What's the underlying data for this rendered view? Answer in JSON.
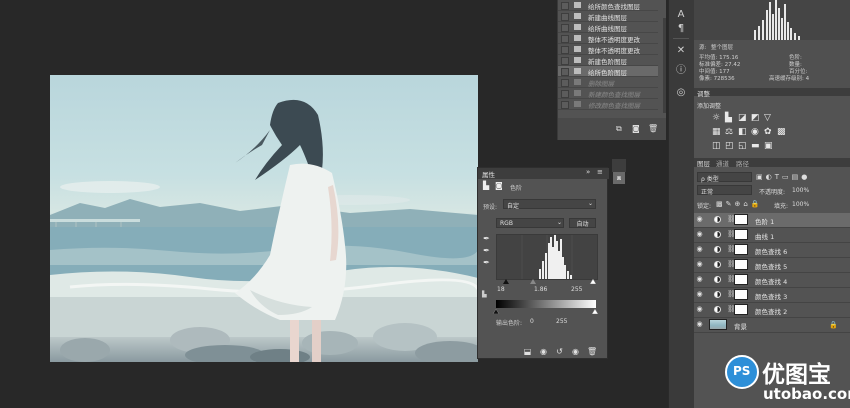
{
  "history": {
    "items": [
      {
        "label": "给所颜色查找图层",
        "state": "normal"
      },
      {
        "label": "新建曲线图层",
        "state": "normal"
      },
      {
        "label": "给所曲线图层",
        "state": "normal"
      },
      {
        "label": "整体不透明度更改",
        "state": "normal"
      },
      {
        "label": "整体不透明度更改",
        "state": "normal"
      },
      {
        "label": "新建色阶图层",
        "state": "normal"
      },
      {
        "label": "给所色阶图层",
        "state": "selected"
      },
      {
        "label": "删除图层",
        "state": "dim"
      },
      {
        "label": "新建颜色查找图层",
        "state": "dim"
      },
      {
        "label": "修改颜色查找图层",
        "state": "dim"
      }
    ]
  },
  "info": {
    "source_label": "源:",
    "source_value": "整个图层",
    "mean": "平均值: 175.16",
    "stddev": "标准偏差: 27.42",
    "median": "中间值: 177",
    "pixels": "像素: 728536",
    "level": "色阶:",
    "count": "数量:",
    "percentile": "百分位:",
    "cache": "高速缓存级别: 4"
  },
  "adjustments": {
    "tab": "调整",
    "title": "添加调整"
  },
  "layers_panel": {
    "tabs": [
      "图层",
      "通道",
      "路径"
    ],
    "kind_filter": "ρ 类型",
    "blend_mode": "正常",
    "opacity_label": "不透明度:",
    "opacity_value": "100%",
    "lock_label": "锁定:",
    "fill_label": "填充:",
    "fill_value": "100%",
    "layers": [
      {
        "name": "色阶 1",
        "selected": true,
        "type": "adjustment"
      },
      {
        "name": "曲线 1",
        "selected": false,
        "type": "adjustment"
      },
      {
        "name": "颜色查找 6",
        "selected": false,
        "type": "adjustment"
      },
      {
        "name": "颜色查找 5",
        "selected": false,
        "type": "adjustment"
      },
      {
        "name": "颜色查找 4",
        "selected": false,
        "type": "adjustment"
      },
      {
        "name": "颜色查找 3",
        "selected": false,
        "type": "adjustment"
      },
      {
        "name": "颜色查找 2",
        "selected": false,
        "type": "adjustment"
      },
      {
        "name": "背景",
        "selected": false,
        "type": "background"
      }
    ]
  },
  "properties": {
    "title": "属性",
    "subtitle": "色阶",
    "preset_label": "预设:",
    "preset_value": "自定",
    "channel_value": "RGB",
    "auto_button": "自动",
    "input_black": "18",
    "input_gamma": "1.86",
    "input_white": "255",
    "output_label": "输出色阶:",
    "output_black": "0",
    "output_white": "255"
  },
  "watermark": {
    "brand": "优图宝",
    "url": "utobao.com",
    "badge": "PS"
  },
  "colors": {
    "panel_bg": "#535353",
    "panel_dark": "#3d3d3d",
    "app_bg": "#282828",
    "selected_row": "#6b6b6b",
    "accent_blue": "#2d8fd8"
  }
}
